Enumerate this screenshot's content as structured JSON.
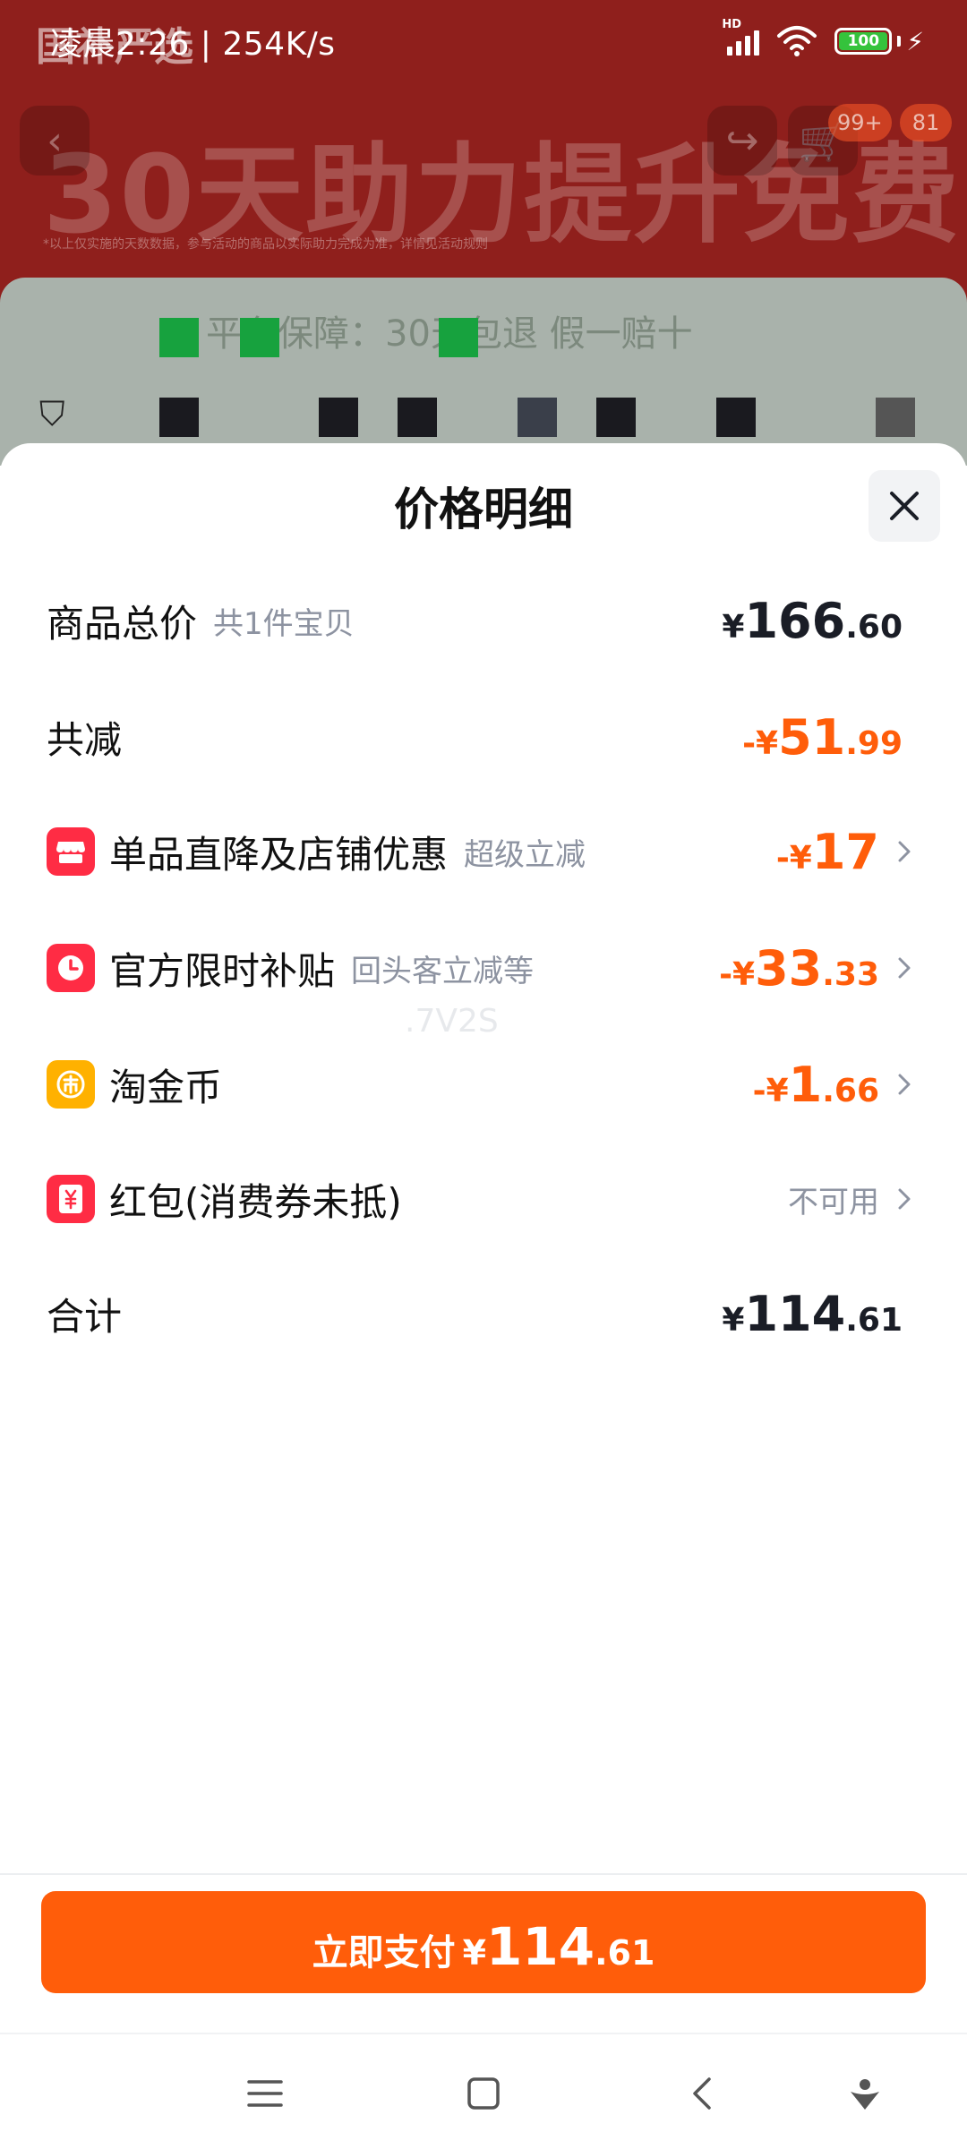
{
  "status_bar": {
    "time_speed": "凌晨2:26 | 254K/s",
    "signal_label": "HD",
    "battery_level": "100"
  },
  "background": {
    "logo": "国补严选",
    "banner": "30天助力提升免费",
    "small_text": "*以上仅实施的天数数据，参与活动的商品以实际助力完成为准，详情见活动规则",
    "cart_badge": "99+",
    "more_badge": "81",
    "guarantee_text": "平台保障：30天包退 假一赔十"
  },
  "sheet": {
    "title": "价格明细",
    "rows": [
      {
        "label": "商品总价",
        "sub": "共1件宝贝",
        "price": {
          "symbol": "¥",
          "int": "166",
          "dec": ".60"
        },
        "color": "black",
        "chevron": false
      },
      {
        "label": "共减",
        "sub": "",
        "price": {
          "symbol": "-¥",
          "int": "51",
          "dec": ".99"
        },
        "color": "orange",
        "chevron": false
      },
      {
        "label": "单品直降及店铺优惠",
        "sub": "超级立减",
        "icon": "store-icon",
        "price": {
          "symbol": "-¥",
          "int": "17",
          "dec": ""
        },
        "color": "orange",
        "chevron": true
      },
      {
        "label": "官方限时补贴",
        "sub": "回头客立减等",
        "icon": "clock-icon",
        "price": {
          "symbol": "-¥",
          "int": "33",
          "dec": ".33"
        },
        "color": "orange",
        "chevron": true
      },
      {
        "label": "淘金币",
        "sub": "",
        "icon": "coin-icon",
        "price": {
          "symbol": "-¥",
          "int": "1",
          "dec": ".66"
        },
        "color": "orange",
        "chevron": true
      },
      {
        "label": "红包(消费券未抵)",
        "sub": "",
        "icon": "red-packet-icon",
        "status": "不可用",
        "chevron": true
      },
      {
        "label": "合计",
        "sub": "",
        "price": {
          "symbol": "¥",
          "int": "114",
          "dec": ".61"
        },
        "color": "black",
        "chevron": false
      }
    ],
    "watermark": ".7V2S"
  },
  "footer": {
    "pay_label": "立即支付",
    "price": {
      "symbol": "¥",
      "int": "114",
      "dec": ".61"
    }
  },
  "colors": {
    "accent": "#ff5d0a",
    "icon_red": "#ff2c44",
    "icon_gold": "#ffb100",
    "price_black": "#1a1d26",
    "muted": "#8d93a1"
  }
}
